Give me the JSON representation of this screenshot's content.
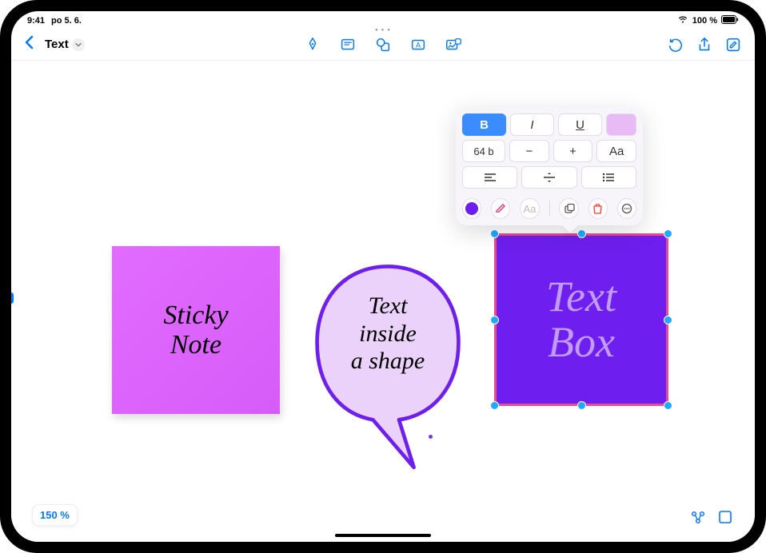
{
  "status": {
    "time": "9:41",
    "date": "po 5. 6.",
    "wifi_level": 3,
    "battery_pct": "100 %"
  },
  "topbar": {
    "doc_title": "Text"
  },
  "canvas": {
    "sticky_note_text": "Sticky\nNote",
    "bubble_text": "Text\ninside\na shape",
    "textbox_text": "Text\nBox"
  },
  "format_popover": {
    "bold_label": "B",
    "italic_label": "I",
    "underline_label": "U",
    "font_size_label": "64 b",
    "minus_label": "−",
    "plus_label": "+",
    "font_case_label": "Aa",
    "text_tool_label": "Aa"
  },
  "bottom": {
    "zoom_label": "150 %"
  }
}
